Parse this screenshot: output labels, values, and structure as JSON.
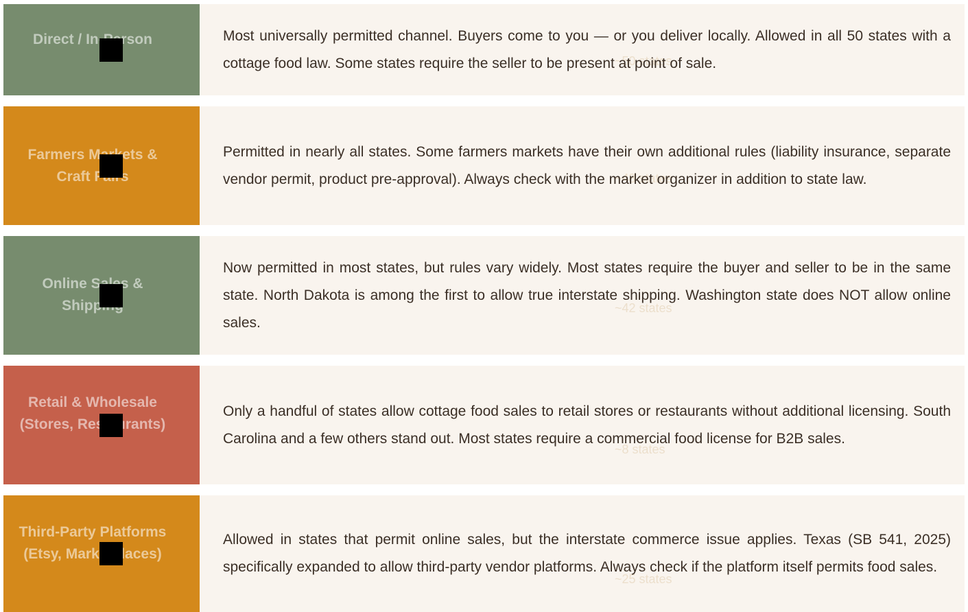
{
  "channels": [
    {
      "name": "Direct / In-Person",
      "count": "~50 states",
      "color": "#778c6e",
      "description": "Most universally permitted channel. Buyers come to you — or you deliver locally. Allowed in all 50 states with a cottage food law. Some states require the seller to be present at point of sale."
    },
    {
      "name": "Farmers Markets & Craft Fairs",
      "count": "~48 states",
      "color": "#d4891b",
      "description": "Permitted in nearly all states. Some farmers markets have their own additional rules (liability insurance, separate vendor permit, product pre-approval). Always check with the market organizer in addition to state law."
    },
    {
      "name": "Online Sales & Shipping",
      "count": "~42 states",
      "color": "#778c6e",
      "description": "Now permitted in most states, but rules vary widely. Most states require the buyer and seller to be in the same state. North Dakota is among the first to allow true interstate shipping. Washington state does NOT allow online sales."
    },
    {
      "name": "Retail & Wholesale (Stores, Restaurants)",
      "count": "~8 states",
      "color": "#c5604b",
      "description": "Only a handful of states allow cottage food sales to retail stores or restaurants without additional licensing. South Carolina and a few others stand out. Most states require a commercial food license for B2B sales."
    },
    {
      "name": "Third-Party Platforms (Etsy, Marketplaces)",
      "count": "~25 states",
      "color": "#d4891b",
      "description": "Allowed in states that permit online sales, but the interstate commerce issue applies. Texas (SB 541, 2025) specifically expanded to allow third-party vendor platforms. Always check if the platform itself permits food sales."
    }
  ]
}
